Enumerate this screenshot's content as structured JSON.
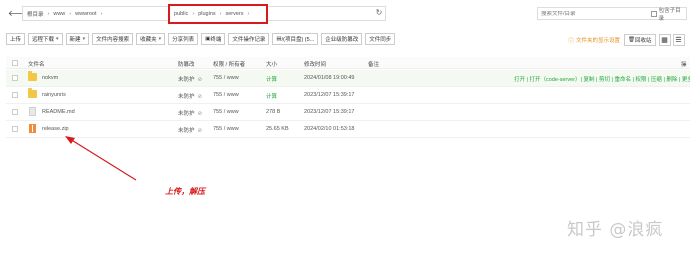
{
  "pathbar": {
    "back": "🡐",
    "crumbs": [
      "根目录",
      "www",
      "wwwroot"
    ],
    "highlighted_crumbs": [
      "public",
      "plugins",
      "servers"
    ],
    "refresh": "↻",
    "search_placeholder": "搜索文件/目录",
    "search_sub_label": "包含子目录"
  },
  "toolbar": {
    "buttons": [
      "上传",
      "远程下载",
      "新建",
      "文件内容搜索",
      "收藏夹",
      "分享列表",
      "终端",
      "文件操作记录",
      "/(项目盘) (5...",
      "企业级防篡改",
      "文件同步"
    ],
    "tip": "文件夹的显示设置",
    "recycle": "回收站",
    "grid_icon": "▦",
    "list_icon": "☰"
  },
  "table": {
    "headers": {
      "name": "文件名",
      "protect": "防篡改",
      "perm": "权限 / 所有者",
      "size": "大小",
      "mtime": "修改时间",
      "note": "备注",
      "ops": "操"
    },
    "rows": [
      {
        "name": "nokvm",
        "type": "folder",
        "protect": "未防护",
        "perm": "755 / www",
        "size": "计算",
        "mtime": "2024/01/08 19:00:49",
        "ops": "打开 | 打开（code-server）| 复制 | 剪切 | 重命名 | 权限 | 压缩 | 删除 | 更多"
      },
      {
        "name": "rainyunris",
        "type": "folder",
        "protect": "未防护",
        "perm": "755 / www",
        "size": "计算",
        "mtime": "2023/12/07 15:39:17",
        "ops": ""
      },
      {
        "name": "README.md",
        "type": "doc",
        "protect": "未防护",
        "perm": "755 / www",
        "size": "278 B",
        "mtime": "2023/12/07 15:39:17",
        "ops": ""
      },
      {
        "name": "release.zip",
        "type": "zip",
        "protect": "未防护",
        "perm": "755 / www",
        "size": "25.65 KB",
        "mtime": "2024/02/10 01:53:18",
        "ops": ""
      }
    ]
  },
  "annotation": {
    "text": "上传，解压"
  },
  "watermark": "知乎 @浪疯",
  "colors": {
    "accent": "#20a53a",
    "highlight": "#d9191c",
    "warning": "#e2931c"
  }
}
